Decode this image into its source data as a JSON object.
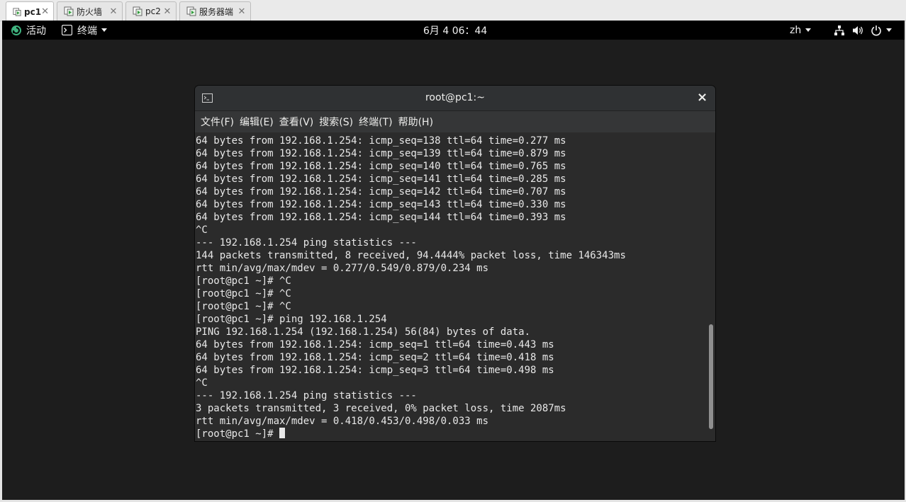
{
  "vm_tabs": [
    {
      "label": "pc1",
      "active": true
    },
    {
      "label": "防火墙",
      "active": false
    },
    {
      "label": "pc2",
      "active": false
    },
    {
      "label": "服务器端",
      "active": false
    }
  ],
  "topbar": {
    "activities": "活动",
    "app_menu": "终端",
    "clock": "6月 4  06：44",
    "input_method": "zh"
  },
  "terminal": {
    "title": "root@pc1:~",
    "close_symbol": "×",
    "menus": [
      "文件(F)",
      "编辑(E)",
      "查看(V)",
      "搜索(S)",
      "终端(T)",
      "帮助(H)"
    ],
    "scroll_position": 0.9,
    "lines": [
      "64 bytes from 192.168.1.254: icmp_seq=138 ttl=64 time=0.277 ms",
      "64 bytes from 192.168.1.254: icmp_seq=139 ttl=64 time=0.879 ms",
      "64 bytes from 192.168.1.254: icmp_seq=140 ttl=64 time=0.765 ms",
      "64 bytes from 192.168.1.254: icmp_seq=141 ttl=64 time=0.285 ms",
      "64 bytes from 192.168.1.254: icmp_seq=142 ttl=64 time=0.707 ms",
      "64 bytes from 192.168.1.254: icmp_seq=143 ttl=64 time=0.330 ms",
      "64 bytes from 192.168.1.254: icmp_seq=144 ttl=64 time=0.393 ms",
      "^C",
      "--- 192.168.1.254 ping statistics ---",
      "144 packets transmitted, 8 received, 94.4444% packet loss, time 146343ms",
      "rtt min/avg/max/mdev = 0.277/0.549/0.879/0.234 ms",
      "[root@pc1 ~]# ^C",
      "[root@pc1 ~]# ^C",
      "[root@pc1 ~]# ^C",
      "[root@pc1 ~]# ping 192.168.1.254",
      "PING 192.168.1.254 (192.168.1.254) 56(84) bytes of data.",
      "64 bytes from 192.168.1.254: icmp_seq=1 ttl=64 time=0.443 ms",
      "64 bytes from 192.168.1.254: icmp_seq=2 ttl=64 time=0.418 ms",
      "64 bytes from 192.168.1.254: icmp_seq=3 ttl=64 time=0.498 ms",
      "^C",
      "--- 192.168.1.254 ping statistics ---",
      "3 packets transmitted, 3 received, 0% packet loss, time 2087ms",
      "rtt min/avg/max/mdev = 0.418/0.453/0.498/0.033 ms"
    ],
    "prompt": "[root@pc1 ~]# "
  }
}
